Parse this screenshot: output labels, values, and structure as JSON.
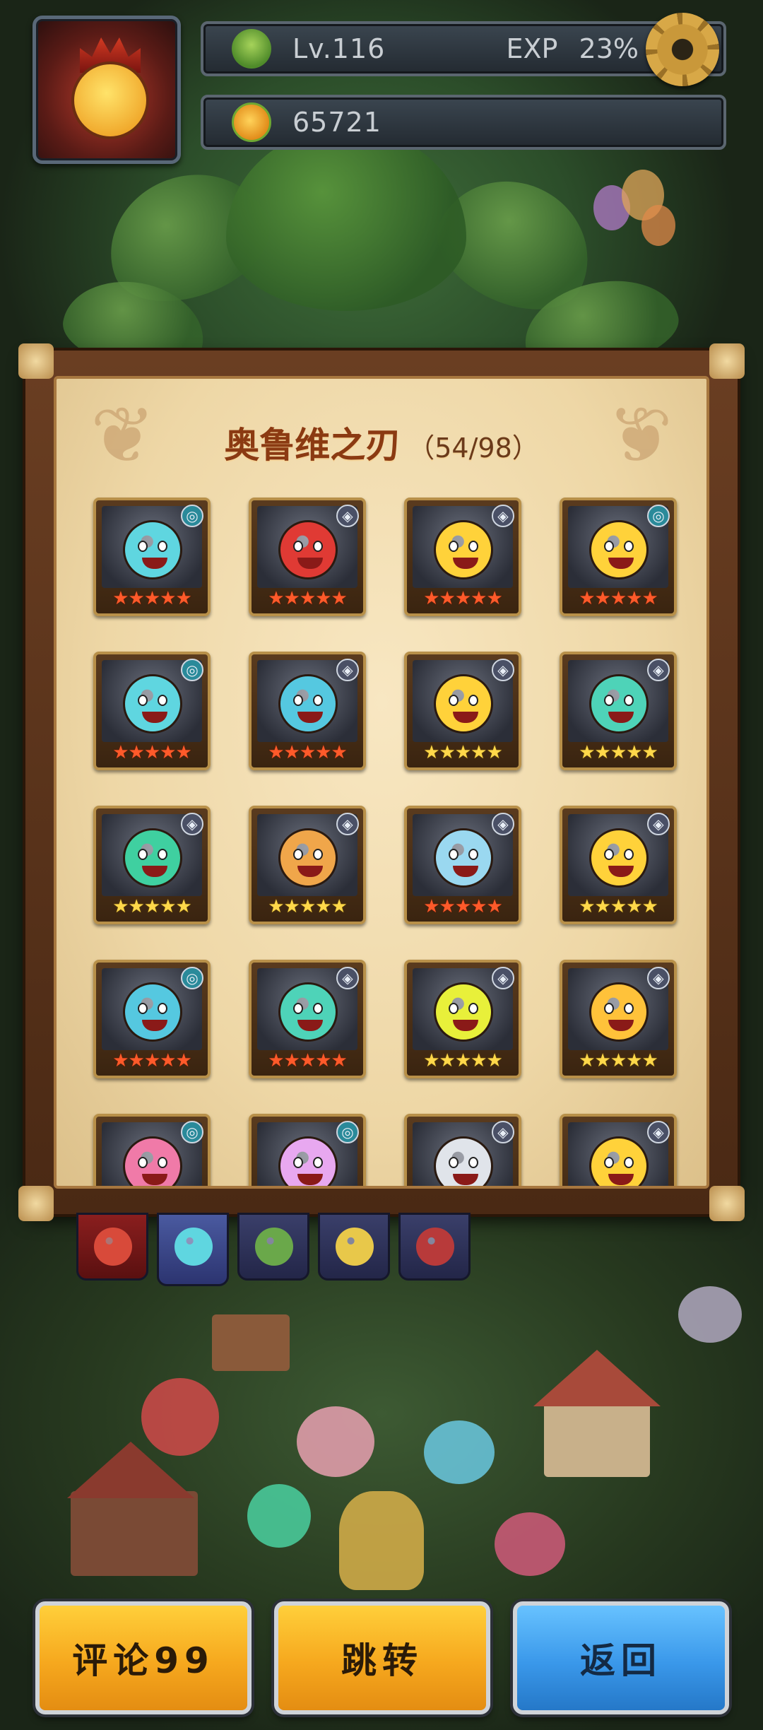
{
  "hud": {
    "level": "Lv.116",
    "exp_label": "EXP",
    "exp_value": "23%",
    "coins": "65721",
    "icons": {
      "level": "tree-icon",
      "coins": "fruit-icon",
      "settings": "gear-icon"
    }
  },
  "album": {
    "title": "奥鲁维之刃",
    "count": "（54/98）",
    "cards": [
      {
        "face": "#5fd6e0",
        "star_color": "red",
        "stars": 5,
        "badge": "swirl"
      },
      {
        "face": "#e03a34",
        "star_color": "red",
        "stars": 5,
        "badge": "blade"
      },
      {
        "face": "#ffd23a",
        "star_color": "red",
        "stars": 5,
        "badge": "blade"
      },
      {
        "face": "#ffd23a",
        "star_color": "red",
        "stars": 5,
        "badge": "swirl"
      },
      {
        "face": "#5fd6e0",
        "star_color": "red",
        "stars": 5,
        "badge": "swirl"
      },
      {
        "face": "#55c8e0",
        "star_color": "red",
        "stars": 5,
        "badge": "blade"
      },
      {
        "face": "#ffd23a",
        "star_color": "gold",
        "stars": 5,
        "badge": "blade"
      },
      {
        "face": "#4ed3b8",
        "star_color": "gold",
        "stars": 5,
        "badge": "blade"
      },
      {
        "face": "#3fd0a0",
        "star_color": "gold",
        "stars": 5,
        "badge": "blade"
      },
      {
        "face": "#f0a64a",
        "star_color": "gold",
        "stars": 5,
        "badge": "blade"
      },
      {
        "face": "#9ad8f0",
        "star_color": "red",
        "stars": 5,
        "badge": "blade"
      },
      {
        "face": "#ffd23a",
        "star_color": "gold",
        "stars": 5,
        "badge": "blade"
      },
      {
        "face": "#55c8e0",
        "star_color": "red",
        "stars": 5,
        "badge": "swirl"
      },
      {
        "face": "#4ed3b8",
        "star_color": "red",
        "stars": 5,
        "badge": "blade"
      },
      {
        "face": "#e8f03a",
        "star_color": "gold",
        "stars": 5,
        "badge": "blade"
      },
      {
        "face": "#ffc23a",
        "star_color": "gold",
        "stars": 5,
        "badge": "blade"
      },
      {
        "face": "#f07aa8",
        "star_color": "red",
        "stars": 0,
        "badge": "swirl"
      },
      {
        "face": "#e8a8f0",
        "star_color": "red",
        "stars": 0,
        "badge": "swirl"
      },
      {
        "face": "#e0e4ea",
        "star_color": "gold",
        "stars": 0,
        "badge": "blade"
      },
      {
        "face": "#ffd23a",
        "star_color": "gold",
        "stars": 0,
        "badge": "blade"
      }
    ]
  },
  "tabs": [
    {
      "color": "#d84a3a",
      "active": false
    },
    {
      "color": "#5fd6e0",
      "active": true
    },
    {
      "color": "#6aa84a",
      "active": false
    },
    {
      "color": "#e8c84a",
      "active": false
    },
    {
      "color": "#b83a3a",
      "active": false
    }
  ],
  "buttons": {
    "review": "评论99",
    "jump": "跳转",
    "back": "返回"
  }
}
